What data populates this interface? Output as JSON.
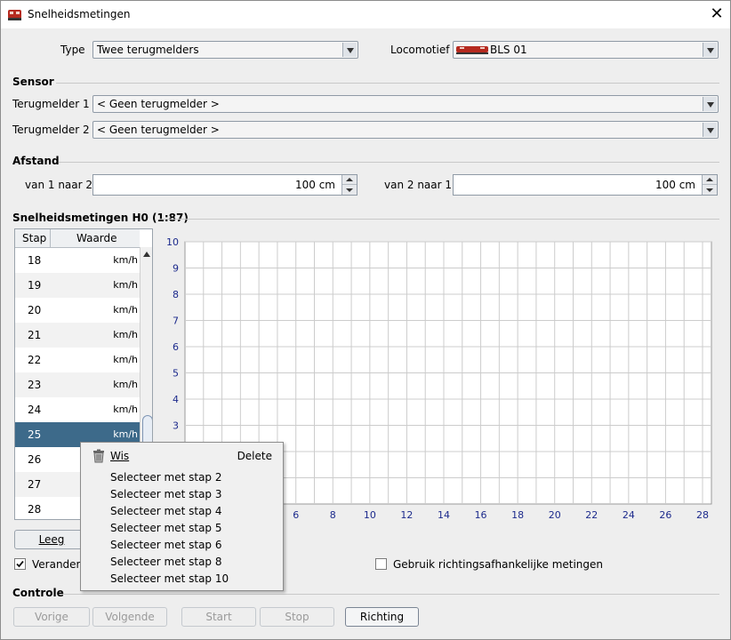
{
  "window": {
    "title": "Snelheidsmetingen"
  },
  "type": {
    "label": "Type",
    "value": "Twee terugmelders"
  },
  "locomotive": {
    "label": "Locomotief",
    "value": "BLS 01"
  },
  "sensor": {
    "section": "Sensor",
    "s1_label": "Terugmelder 1",
    "s1_value": "< Geen terugmelder >",
    "s2_label": "Terugmelder 2",
    "s2_value": "< Geen terugmelder >"
  },
  "distance": {
    "section": "Afstand",
    "d1_label": "van 1 naar 2",
    "d1_value": "100 cm",
    "d2_label": "van 2 naar 1",
    "d2_value": "100 cm"
  },
  "measurements": {
    "section": "Snelheidsmetingen H0 (1:87)",
    "col_step": "Stap",
    "col_value": "Waarde",
    "rows": [
      {
        "step": "18",
        "unit": "km/h"
      },
      {
        "step": "19",
        "unit": "km/h"
      },
      {
        "step": "20",
        "unit": "km/h"
      },
      {
        "step": "21",
        "unit": "km/h"
      },
      {
        "step": "22",
        "unit": "km/h"
      },
      {
        "step": "23",
        "unit": "km/h"
      },
      {
        "step": "24",
        "unit": "km/h"
      },
      {
        "step": "25",
        "unit": "km/h"
      },
      {
        "step": "26",
        "unit": "km/h"
      },
      {
        "step": "27",
        "unit": "km/h"
      },
      {
        "step": "28",
        "unit": "km/h"
      }
    ],
    "selected_step": "25"
  },
  "chart_data": {
    "type": "line",
    "title": "",
    "xlabel": "",
    "ylabel": "",
    "xlim": [
      0,
      28
    ],
    "ylim": [
      0,
      10
    ],
    "x_ticks": [
      "6",
      "8",
      "10",
      "12",
      "14",
      "16",
      "18",
      "20",
      "22",
      "24",
      "26",
      "28"
    ],
    "y_ticks": [
      "10",
      "9",
      "8",
      "7",
      "6",
      "5",
      "4",
      "3"
    ],
    "grid": true,
    "series": []
  },
  "buttons": {
    "clear": "Leeg",
    "change_label": "Verander",
    "direction_dependent": "Gebruik richtingsafhankelijke metingen"
  },
  "controle": {
    "section": "Controle",
    "prev": "Vorige",
    "next": "Volgende",
    "start": "Start",
    "stop": "Stop",
    "direction": "Richting"
  },
  "context_menu": {
    "delete_label": "Wis",
    "delete_accel": "Delete",
    "items": [
      "Selecteer met stap 2",
      "Selecteer met stap 3",
      "Selecteer met stap 4",
      "Selecteer met stap 5",
      "Selecteer met stap 6",
      "Selecteer met stap 8",
      "Selecteer met stap 10"
    ]
  },
  "colors": {
    "selection": "#3d6a8a",
    "tick_label": "#1c2a8c",
    "grid": "#cccccc"
  }
}
